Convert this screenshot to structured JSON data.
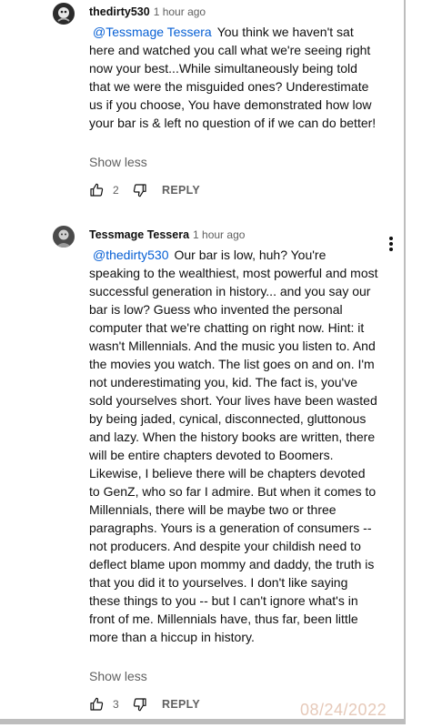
{
  "comments": [
    {
      "author": "thedirty530",
      "time": "1 hour ago",
      "mention": "@Tessmage Tessera",
      "text": "You think we haven't sat here and watched you call what we're seeing right now your best...While simultaneously being told that we were the misguided ones? Underestimate us if you choose, You have demonstrated how low your bar is & left no question of if we can do better!",
      "show_less": "Show less",
      "likes": "2",
      "reply": "REPLY"
    },
    {
      "author": "Tessmage Tessera",
      "time": "1 hour ago",
      "mention": "@thedirty530",
      "text": "Our bar is low, huh? You're speaking to the wealthiest, most powerful and most successful generation in history... and you say our bar is low? Guess who invented the personal computer that we're chatting on right now. Hint: it wasn't Millennials. And the music you listen to. And the movies you watch. The list goes on and on. I'm not underestimating you, kid. The fact is, you've sold yourselves short. Your lives have been wasted by being jaded, cynical, disconnected, gluttonous and lazy. When the history books are written, there will be entire chapters devoted to Boomers. Likewise, I believe there will be chapters devoted to GenZ, who so far I admire. But when it comes to Millennials, there will be maybe two or three paragraphs. Yours is a generation of consumers -- not producers. And despite your childish need to deflect blame upon mommy and daddy, the truth is that you did it to yourselves. I don't like saying these things to you -- but I can't ignore what's in front of me. Millennials have, thus far, been little more than a hiccup in history.",
      "show_less": "Show less",
      "likes": "3",
      "reply": "REPLY"
    }
  ],
  "watermark": "08/24/2022",
  "icons": {
    "like": "thumbs-up-icon",
    "dislike": "thumbs-down-icon",
    "menu": "more-vert-icon"
  }
}
